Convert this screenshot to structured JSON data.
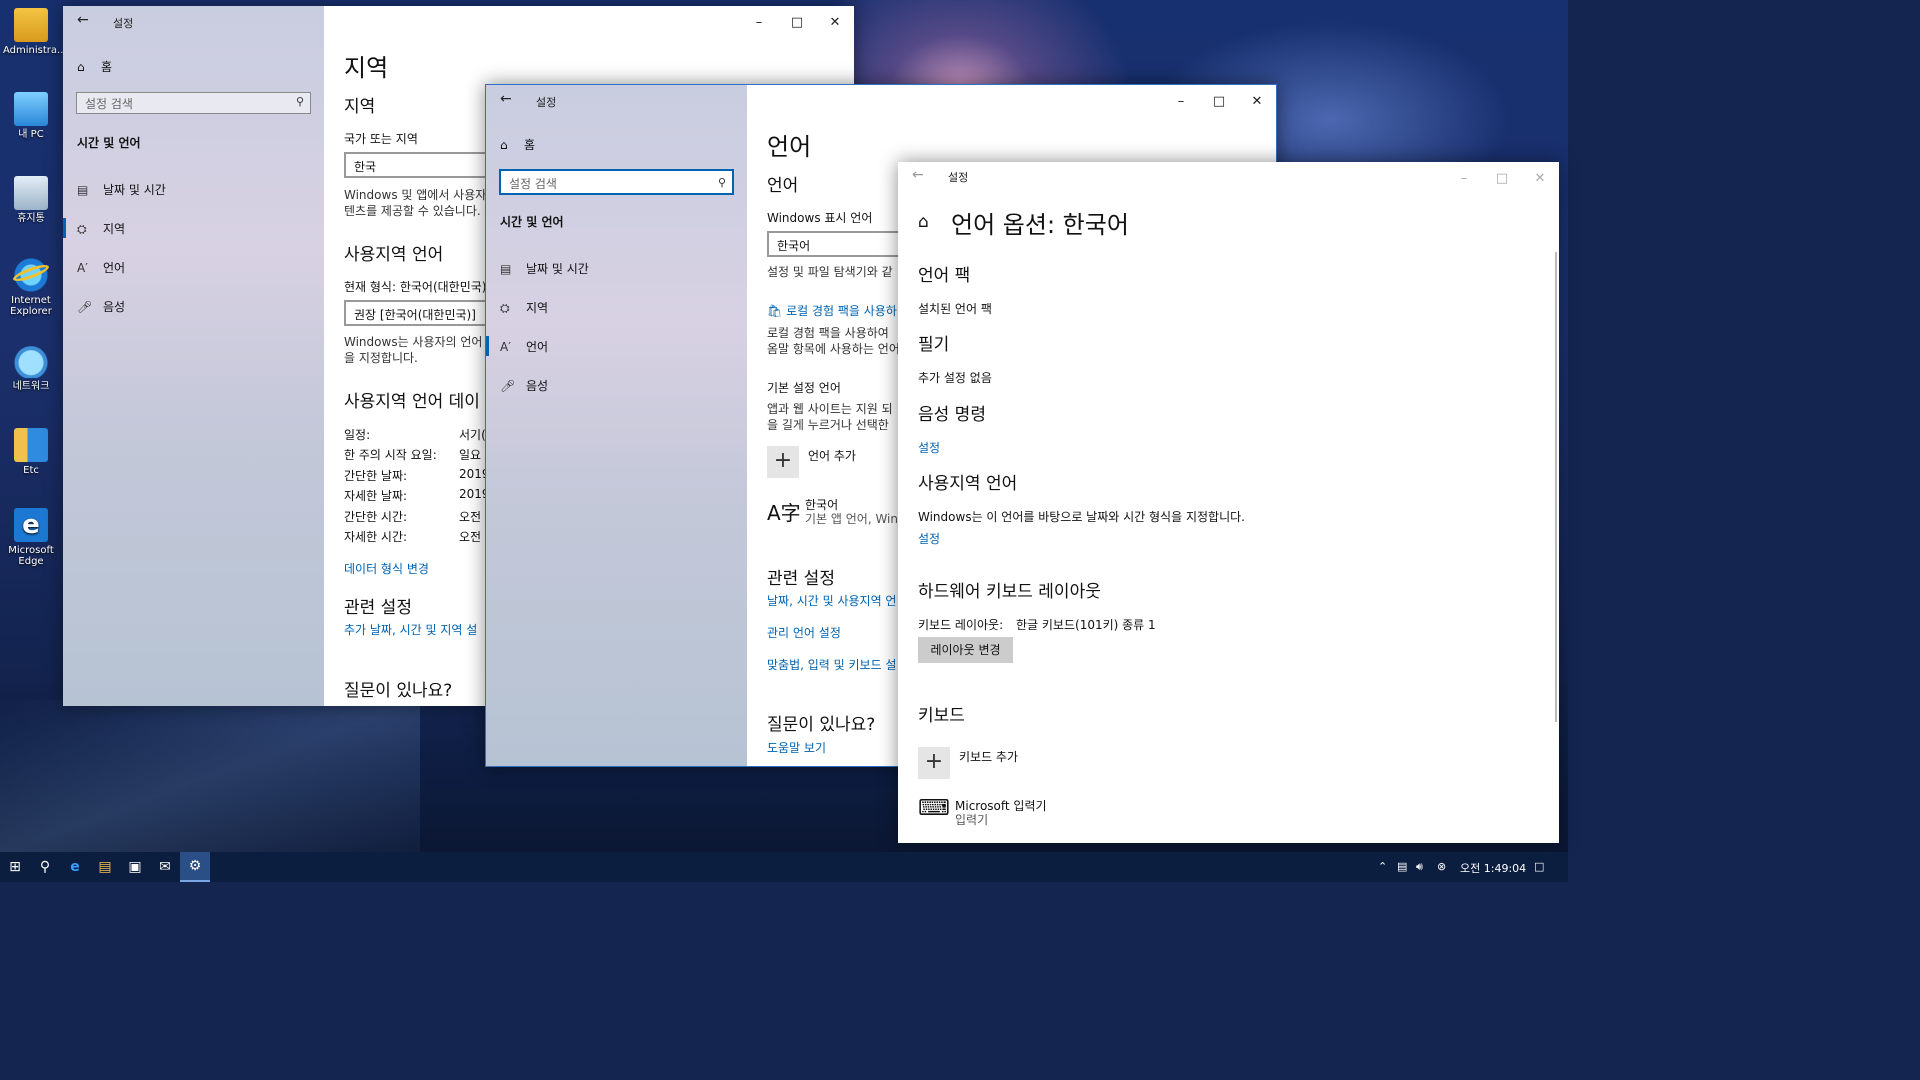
{
  "desktop": {
    "icons": [
      {
        "label": "Administra...",
        "icon": "user-folder-icon"
      },
      {
        "label": "내 PC",
        "icon": "pc-icon"
      },
      {
        "label": "휴지통",
        "icon": "recycle-bin-icon"
      },
      {
        "label": "Internet Explorer",
        "icon": "internet-explorer-icon"
      },
      {
        "label": "네트워크",
        "icon": "network-icon"
      },
      {
        "label": "Etc",
        "icon": "etc-folder-icon"
      },
      {
        "label": "Microsoft Edge",
        "icon": "edge-icon"
      }
    ]
  },
  "common": {
    "title": "설정",
    "home": "홈",
    "search_placeholder": "설정 검색",
    "section": "시간 및 언어",
    "nav": [
      "날짜 및 시간",
      "지역",
      "언어",
      "음성"
    ]
  },
  "win1": {
    "page_title": "지역",
    "region_header": "지역",
    "country_label": "국가 또는 지역",
    "country_value": "한국",
    "country_desc": [
      "Windows 및 앱에서 사용자",
      "텐츠를 제공할 수 있습니다."
    ],
    "locale_header": "사용지역 언어",
    "current_format": "현재 형식: 한국어(대한민국)",
    "format_value": "권장 [한국어(대한민국)]",
    "locale_desc": [
      "Windows는 사용자의 언어",
      "을 지정합니다."
    ],
    "data_header": "사용지역 언어 데이",
    "data_rows": [
      {
        "k": "일정:",
        "v": "서기("
      },
      {
        "k": "한 주의 시작 요일:",
        "v": "일요"
      },
      {
        "k": "간단한 날짜:",
        "v": "2019"
      },
      {
        "k": "자세한 날짜:",
        "v": "2019"
      },
      {
        "k": "간단한 시간:",
        "v": "오전"
      },
      {
        "k": "자세한 시간:",
        "v": "오전"
      }
    ],
    "change_format": "데이터 형식 변경",
    "related_header": "관련 설정",
    "related_link": "추가 날짜, 시간 및 지역 설",
    "question": "질문이 있나요?"
  },
  "win2": {
    "page_title": "언어",
    "lang_header": "언어",
    "display_label": "Windows 표시 언어",
    "display_value": "한국어",
    "display_desc": "설정 및 파일 탐색기와 같",
    "local_pack_link": "로컬 경험 팩을 사용하",
    "local_pack_desc": [
      "로컬 경험 팩을 사용하여 ",
      "옴말 항목에 사용하는 언어"
    ],
    "pref_header": "기본 설정 언어",
    "pref_desc": [
      "앱과 웹 사이트는 지원 되",
      "을 길게 누르거나 선택한"
    ],
    "add_language": "언어 추가",
    "lang_item_name": "한국어",
    "lang_item_desc": "기본 앱 언어, Win",
    "related_header": "관련 설정",
    "related_links": [
      "날짜, 시간 및 사용지역 언",
      "관리 언어 설정",
      "맞춤법, 입력 및 키보드 설"
    ],
    "question": "질문이 있나요?",
    "help_link": "도움말 보기"
  },
  "win3": {
    "page_title": "언어 옵션: 한국어",
    "pack_header": "언어 팩",
    "pack_status": "설치된 언어 팩",
    "handwriting_header": "필기",
    "handwriting_status": "추가 설정 없음",
    "speech_header": "음성 명령",
    "speech_link": "설정",
    "locale_header": "사용지역 언어",
    "locale_desc": "Windows는 이 언어를 바탕으로 날짜와 시간 형식을 지정합니다.",
    "locale_link": "설정",
    "hw_header": "하드웨어 키보드 레이아웃",
    "layout_label": "키보드 레이아웃:",
    "layout_value": "한글 키보드(101키) 종류 1",
    "change_layout": "레이아웃 변경",
    "keyboard_header": "키보드",
    "add_keyboard": "키보드 추가",
    "ime_name": "Microsoft 입력기",
    "ime_type": "입력기"
  },
  "taskbar": {
    "clock": "오전 1:49:04"
  },
  "colors": {
    "accent": "#0063b1",
    "taskbar": "#0c1e3f"
  }
}
